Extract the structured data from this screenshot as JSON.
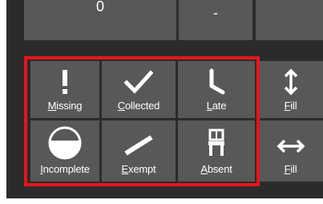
{
  "top_row": {
    "value_1": "0",
    "value_2": "-",
    "value_3": ""
  },
  "status_buttons": {
    "missing": "Missing",
    "collected": "Collected",
    "late": "Late",
    "incomplete": "Incomplete",
    "exempt": "Exempt",
    "absent": "Absent"
  },
  "fill_buttons": {
    "fill_vertical": "Fill",
    "fill_horizontal": "Fill"
  },
  "colors": {
    "button_bg": "#585858",
    "panel_bg": "#2b2b2b",
    "highlight": "#e8141c"
  }
}
